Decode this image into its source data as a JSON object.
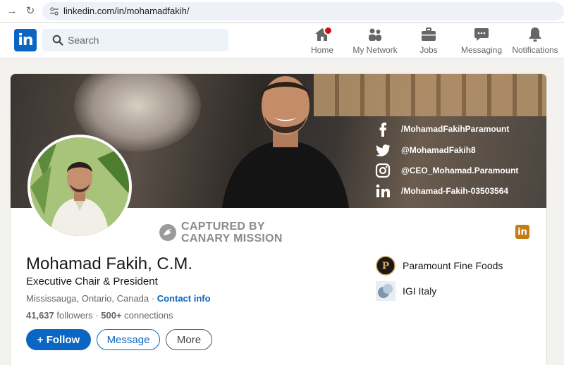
{
  "browser": {
    "url": "linkedin.com/in/mohamadfakih/"
  },
  "nav": {
    "search_placeholder": "Search",
    "items": [
      {
        "label": "Home"
      },
      {
        "label": "My Network"
      },
      {
        "label": "Jobs"
      },
      {
        "label": "Messaging"
      },
      {
        "label": "Notifications"
      }
    ]
  },
  "banner": {
    "socials": [
      {
        "icon": "facebook-icon",
        "text": "/MohamadFakihParamount"
      },
      {
        "icon": "twitter-icon",
        "text": "@MohamadFakih8"
      },
      {
        "icon": "instagram-icon",
        "text": "@CEO_Mohamad.Paramount"
      },
      {
        "icon": "linkedin-icon",
        "text": "/Mohamad-Fakih-03503564"
      }
    ]
  },
  "watermark": {
    "line1": "CAPTURED BY",
    "line2": "CANARY MISSION"
  },
  "profile": {
    "name": "Mohamad Fakih, C.M.",
    "headline": "Executive Chair & President",
    "location": "Mississauga, Ontario, Canada",
    "location_sep": " · ",
    "contact_label": "Contact info",
    "followers": "41,637",
    "followers_label": " followers",
    "stats_sep": "  · ",
    "connections": "500+",
    "connections_label": " connections"
  },
  "actions": {
    "follow_label": "+ Follow",
    "message_label": "Message",
    "more_label": "More"
  },
  "companies": [
    {
      "name": "Paramount Fine Foods",
      "icon": "paramount-logo"
    },
    {
      "name": "IGI Italy",
      "icon": "igi-logo"
    }
  ],
  "colors": {
    "brand": "#0a66c2",
    "badge": "#cc1016",
    "premium": "#c37d16"
  }
}
